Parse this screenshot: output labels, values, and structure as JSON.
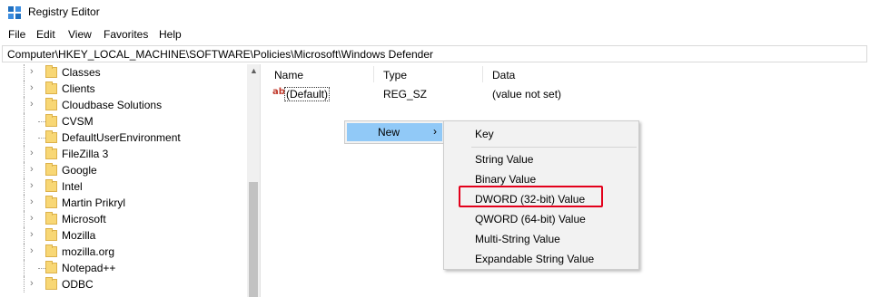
{
  "window": {
    "title": "Registry Editor"
  },
  "menubar": {
    "items": [
      "File",
      "Edit",
      "View",
      "Favorites",
      "Help"
    ]
  },
  "address": {
    "path": "Computer\\HKEY_LOCAL_MACHINE\\SOFTWARE\\Policies\\Microsoft\\Windows Defender"
  },
  "tree": {
    "items": [
      {
        "label": "Classes",
        "expandable": true
      },
      {
        "label": "Clients",
        "expandable": true
      },
      {
        "label": "Cloudbase Solutions",
        "expandable": true
      },
      {
        "label": "CVSM",
        "expandable": false
      },
      {
        "label": "DefaultUserEnvironment",
        "expandable": false
      },
      {
        "label": "FileZilla 3",
        "expandable": true
      },
      {
        "label": "Google",
        "expandable": true
      },
      {
        "label": "Intel",
        "expandable": true
      },
      {
        "label": "Martin Prikryl",
        "expandable": true
      },
      {
        "label": "Microsoft",
        "expandable": true
      },
      {
        "label": "Mozilla",
        "expandable": true
      },
      {
        "label": "mozilla.org",
        "expandable": true
      },
      {
        "label": "Notepad++",
        "expandable": false
      },
      {
        "label": "ODBC",
        "expandable": true
      }
    ]
  },
  "list": {
    "columns": {
      "name": "Name",
      "type": "Type",
      "data": "Data"
    },
    "rows": [
      {
        "name": "(Default)",
        "type": "REG_SZ",
        "data": "(value not set)"
      }
    ]
  },
  "context_menu": {
    "new_label": "New",
    "submenu": {
      "key": "Key",
      "items": [
        "String Value",
        "Binary Value",
        "DWORD (32-bit) Value",
        "QWORD (64-bit) Value",
        "Multi-String Value",
        "Expandable String Value"
      ]
    }
  },
  "colors": {
    "selection": "#91c9f7",
    "highlight_border": "#e3001b",
    "folder": "#f8d775"
  }
}
